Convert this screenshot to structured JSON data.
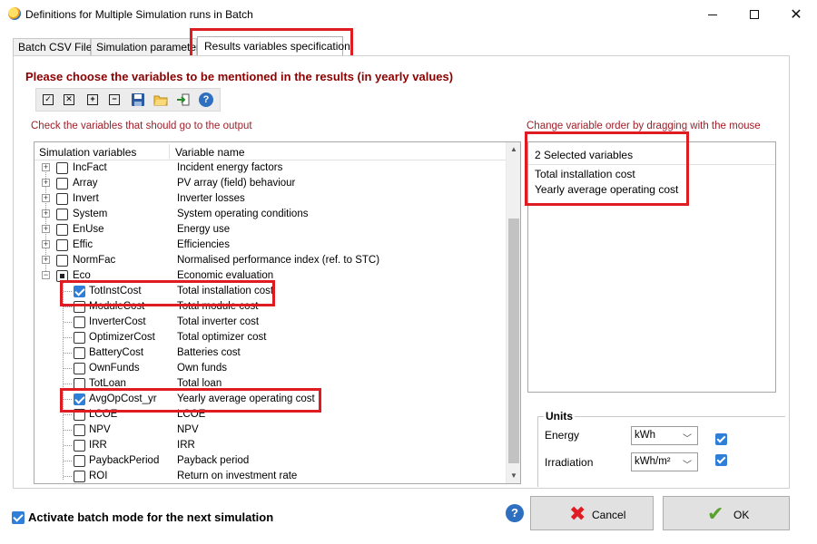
{
  "window": {
    "title": "Definitions for Multiple Simulation runs in Batch"
  },
  "tabs": [
    "Batch CSV Files",
    "Simulation parameter",
    "Results variables specification"
  ],
  "heading": "Please choose the variables to be mentioned in the results (in yearly values)",
  "hint_left": "Check the variables that should go to the output",
  "hint_right": "Change variable order by dragging with the mouse",
  "tree": {
    "col1": "Simulation variables",
    "col2": "Variable name",
    "groups": [
      {
        "name": "IncFact",
        "desc": "Incident energy factors"
      },
      {
        "name": "Array",
        "desc": "PV array (field) behaviour"
      },
      {
        "name": "Invert",
        "desc": "Inverter losses"
      },
      {
        "name": "System",
        "desc": "System operating conditions"
      },
      {
        "name": "EnUse",
        "desc": "Energy use"
      },
      {
        "name": "Effic",
        "desc": "Efficiencies"
      },
      {
        "name": "NormFac",
        "desc": "Normalised performance index (ref. to STC)"
      },
      {
        "name": "Eco",
        "desc": "Economic evaluation"
      }
    ],
    "eco_items": [
      {
        "name": "TotInstCost",
        "desc": "Total installation cost",
        "checked": true
      },
      {
        "name": "ModuleCost",
        "desc": "Total module cost",
        "checked": false
      },
      {
        "name": "InverterCost",
        "desc": "Total inverter cost",
        "checked": false
      },
      {
        "name": "OptimizerCost",
        "desc": "Total optimizer cost",
        "checked": false
      },
      {
        "name": "BatteryCost",
        "desc": "Batteries cost",
        "checked": false
      },
      {
        "name": "OwnFunds",
        "desc": "Own funds",
        "checked": false
      },
      {
        "name": "TotLoan",
        "desc": "Total loan",
        "checked": false
      },
      {
        "name": "AvgOpCost_yr",
        "desc": "Yearly average operating cost",
        "checked": true
      },
      {
        "name": "LCOE",
        "desc": "LCOE",
        "checked": false
      },
      {
        "name": "NPV",
        "desc": "NPV",
        "checked": false
      },
      {
        "name": "IRR",
        "desc": "IRR",
        "checked": false
      },
      {
        "name": "PaybackPeriod",
        "desc": "Payback period",
        "checked": false
      },
      {
        "name": "ROI",
        "desc": "Return on investment rate",
        "checked": false
      }
    ]
  },
  "selected": {
    "header": "2 Selected variables",
    "items": [
      "Total installation cost",
      "Yearly average operating cost"
    ]
  },
  "units": {
    "title": "Units",
    "energy_label": "Energy",
    "energy_value": "kWh",
    "irradiation_label": "Irradiation",
    "irradiation_value": "kWh/m²"
  },
  "batch_label": "Activate batch mode for the next simulation",
  "buttons": {
    "cancel": "Cancel",
    "ok": "OK"
  },
  "colors": {
    "highlight": "#e01c23",
    "heading": "#8b0000",
    "accent": "#2f7fd8"
  }
}
